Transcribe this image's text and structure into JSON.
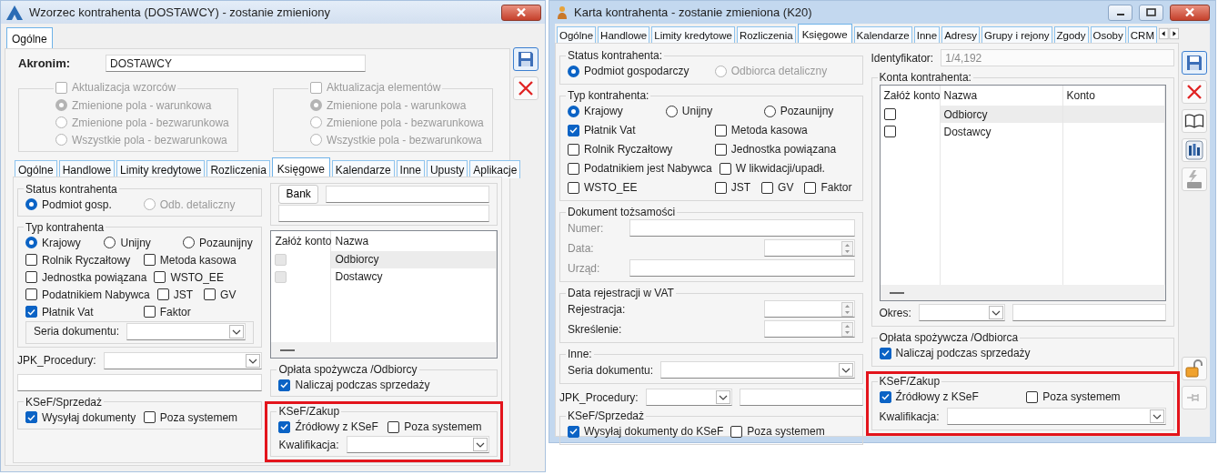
{
  "windows": [
    {
      "title": "Wzorzec kontrahenta (DOSTAWCY) - zostanie zmieniony",
      "title_buttons": [
        {
          "kind": "close"
        }
      ],
      "outer_tabs": [
        {
          "label": "Ogólne",
          "selected": true
        }
      ],
      "header": [
        [
          [
            {
              "kind": "strong",
              "text": "Akronim:"
            }
          ],
          [
            {
              "kind": "field",
              "value": "DOSTAWCY"
            }
          ]
        ],
        {
          "kind": "pair",
          "groups": [
            {
              "kind": "group",
              "title_check": {
                "kind": "check",
                "label": "Aktualizacja wzorców",
                "checked": false
              },
              "disabled": true,
              "highlighted": false,
              "items": [
                [
                  [
                    {
                      "kind": "radio",
                      "label": "Zmienione pola - warunkowa",
                      "selected": true
                    }
                  ]
                ],
                [
                  [
                    {
                      "kind": "radio",
                      "label": "Zmienione pola - bezwarunkowa",
                      "selected": false
                    }
                  ]
                ],
                [
                  [
                    {
                      "kind": "radio",
                      "label": "Wszystkie pola - bezwarunkowa",
                      "selected": false
                    }
                  ]
                ]
              ]
            },
            {
              "kind": "group",
              "title_check": {
                "kind": "check",
                "label": "Aktualizacja elementów",
                "checked": false
              },
              "disabled": true,
              "highlighted": false,
              "items": [
                [
                  [
                    {
                      "kind": "radio",
                      "label": "Zmienione pola - warunkowa",
                      "selected": true
                    }
                  ]
                ],
                [
                  [
                    {
                      "kind": "radio",
                      "label": "Zmienione pola - bezwarunkowa",
                      "selected": false
                    }
                  ]
                ],
                [
                  [
                    {
                      "kind": "radio",
                      "label": "Wszystkie pola - bezwarunkowa",
                      "selected": false
                    }
                  ]
                ]
              ]
            }
          ]
        }
      ],
      "tabs": [
        {
          "label": "Ogólne",
          "selected": false
        },
        {
          "label": "Handlowe",
          "selected": false
        },
        {
          "label": "Limity kredytowe",
          "selected": false
        },
        {
          "label": "Rozliczenia",
          "selected": false
        },
        {
          "label": "Księgowe",
          "selected": true
        },
        {
          "label": "Kalendarze",
          "selected": false
        },
        {
          "label": "Inne",
          "selected": false
        },
        {
          "label": "Upusty",
          "selected": false
        },
        {
          "label": "Aplikacje",
          "selected": false
        }
      ],
      "columns": [
        [
          {
            "kind": "group",
            "title": "Status kontrahenta",
            "highlighted": false,
            "items": [
              [
                [
                  {
                    "kind": "radio",
                    "label": "Podmiot gosp.",
                    "selected": true,
                    "disabled": false
                  }
                ],
                [
                  {
                    "kind": "radio",
                    "label": "Odb. detaliczny",
                    "selected": false,
                    "disabled": true
                  }
                ]
              ]
            ]
          },
          {
            "kind": "group",
            "title": "Typ kontrahenta",
            "highlighted": false,
            "items": [
              [
                [
                  {
                    "kind": "radio",
                    "label": "Krajowy",
                    "selected": true
                  }
                ],
                [
                  {
                    "kind": "radio",
                    "label": "Unijny",
                    "selected": false
                  }
                ],
                [
                  {
                    "kind": "radio",
                    "label": "Pozaunijny",
                    "selected": false
                  }
                ]
              ],
              [
                [
                  {
                    "kind": "check",
                    "label": "Rolnik Ryczałtowy",
                    "checked": false
                  }
                ],
                [
                  {
                    "kind": "check",
                    "label": "Metoda kasowa",
                    "checked": false
                  }
                ]
              ],
              [
                [
                  {
                    "kind": "check",
                    "label": "Jednostka powiązana",
                    "checked": false
                  }
                ],
                [
                  {
                    "kind": "check",
                    "label": "WSTO_EE",
                    "checked": false
                  }
                ]
              ],
              [
                [
                  {
                    "kind": "check",
                    "label": "Podatnikiem Nabywca",
                    "checked": false
                  }
                ],
                [
                  {
                    "kind": "check",
                    "label": "JST",
                    "checked": false
                  },
                  {
                    "kind": "check",
                    "label": "GV",
                    "checked": false
                  }
                ]
              ],
              [
                [
                  {
                    "kind": "check",
                    "label": "Płatnik Vat",
                    "checked": true
                  }
                ],
                [
                  {
                    "kind": "check",
                    "label": "Faktor",
                    "checked": false
                  }
                ]
              ],
              {
                "kind": "group",
                "highlighted": false,
                "items": [
                  [
                    [
                      {
                        "kind": "label",
                        "text": "Seria dokumentu:"
                      }
                    ],
                    [
                      {
                        "kind": "combo"
                      }
                    ]
                  ]
                ]
              }
            ]
          },
          [
            [
              {
                "kind": "label",
                "text": "JPK_Procedury:"
              }
            ],
            [
              {
                "kind": "combo"
              }
            ]
          ],
          [
            [
              {
                "kind": "field"
              }
            ]
          ],
          {
            "kind": "group",
            "title": "KSeF/Sprzedaż",
            "highlighted": false,
            "items": [
              [
                [
                  {
                    "kind": "check",
                    "label": "Wysyłaj dokumenty",
                    "checked": true
                  }
                ],
                [
                  {
                    "kind": "check",
                    "label": "Poza systemem",
                    "checked": false
                  }
                ]
              ]
            ]
          }
        ],
        [
          {
            "kind": "group",
            "highlighted": false,
            "items": [
              [
                [
                  {
                    "kind": "button",
                    "label": "Bank"
                  }
                ],
                [
                  {
                    "kind": "field"
                  }
                ]
              ],
              [
                [
                  {
                    "kind": "field"
                  }
                ]
              ]
            ]
          },
          {
            "kind": "grid",
            "columns": [
              "Załóż konto",
              "Nazwa"
            ],
            "rows": [
              {
                "checked": false,
                "disabled": true,
                "name": "Odbiorcy"
              },
              {
                "checked": false,
                "disabled": true,
                "name": "Dostawcy"
              }
            ]
          },
          {
            "kind": "group",
            "title": "Opłata spożywcza /Odbiorcy",
            "highlighted": false,
            "items": [
              [
                [
                  {
                    "kind": "check",
                    "label": "Naliczaj podczas sprzedaży",
                    "checked": true
                  }
                ]
              ]
            ]
          },
          {
            "kind": "group",
            "title": "KSeF/Zakup",
            "highlighted": true,
            "items": [
              [
                [
                  {
                    "kind": "check",
                    "label": "Źródłowy z KSeF",
                    "checked": true
                  }
                ],
                [
                  {
                    "kind": "check",
                    "label": "Poza systemem",
                    "checked": false
                  }
                ]
              ],
              [
                [
                  {
                    "kind": "label",
                    "text": "Kwalifikacja:"
                  }
                ],
                [
                  {
                    "kind": "combo"
                  }
                ]
              ]
            ]
          }
        ]
      ],
      "toolbar": [
        {
          "kind": "save",
          "disabled": false
        },
        {
          "kind": "cancel",
          "disabled": false
        }
      ]
    },
    {
      "title": "Karta kontrahenta - zostanie zmieniona (K20)",
      "title_buttons": [
        {
          "kind": "min"
        },
        {
          "kind": "max"
        },
        {
          "kind": "close"
        }
      ],
      "tabs": [
        {
          "label": "Ogólne",
          "selected": false
        },
        {
          "label": "Handlowe",
          "selected": false
        },
        {
          "label": "Limity kredytowe",
          "selected": false
        },
        {
          "label": "Rozliczenia",
          "selected": false
        },
        {
          "label": "Księgowe",
          "selected": true
        },
        {
          "label": "Kalendarze",
          "selected": false
        },
        {
          "label": "Inne",
          "selected": false
        },
        {
          "label": "Adresy",
          "selected": false
        },
        {
          "label": "Grupy i rejony",
          "selected": false
        },
        {
          "label": "Zgody",
          "selected": false
        },
        {
          "label": "Osoby",
          "selected": false
        },
        {
          "label": "CRM",
          "selected": false
        }
      ],
      "columns": [
        [
          {
            "kind": "group",
            "title": "Status kontrahenta:",
            "highlighted": false,
            "items": [
              [
                [
                  {
                    "kind": "radio",
                    "label": "Podmiot gospodarczy",
                    "selected": true,
                    "disabled": false
                  }
                ],
                [
                  {
                    "kind": "radio",
                    "label": "Odbiorca detaliczny",
                    "selected": false,
                    "disabled": true
                  }
                ]
              ]
            ]
          },
          {
            "kind": "group",
            "title": "Typ kontrahenta:",
            "highlighted": false,
            "items": [
              [
                [
                  {
                    "kind": "radio",
                    "label": "Krajowy",
                    "selected": true
                  }
                ],
                [
                  {
                    "kind": "radio",
                    "label": "Unijny",
                    "selected": false
                  }
                ],
                [
                  {
                    "kind": "radio",
                    "label": "Pozaunijny",
                    "selected": false
                  }
                ]
              ],
              [
                [
                  {
                    "kind": "check",
                    "label": "Płatnik Vat",
                    "checked": true
                  }
                ],
                [
                  {
                    "kind": "check",
                    "label": "Metoda kasowa",
                    "checked": false
                  }
                ]
              ],
              [
                [
                  {
                    "kind": "check",
                    "label": "Rolnik Ryczałtowy",
                    "checked": false
                  }
                ],
                [
                  {
                    "kind": "check",
                    "label": "Jednostka powiązana",
                    "checked": false
                  }
                ]
              ],
              [
                [
                  {
                    "kind": "check",
                    "label": "Podatnikiem jest Nabywca",
                    "checked": false
                  }
                ],
                [
                  {
                    "kind": "check",
                    "label": "W likwidacji/upadł.",
                    "checked": false
                  }
                ]
              ],
              [
                [
                  {
                    "kind": "check",
                    "label": "WSTO_EE",
                    "checked": false
                  }
                ],
                [
                  {
                    "kind": "check",
                    "label": "JST",
                    "checked": false
                  },
                  {
                    "kind": "check",
                    "label": "GV",
                    "checked": false
                  },
                  {
                    "kind": "check",
                    "label": "Faktor",
                    "checked": false
                  }
                ]
              ]
            ]
          },
          {
            "kind": "group",
            "title": "Dokument tożsamości",
            "highlighted": false,
            "items": [
              [
                [
                  {
                    "kind": "dim-label",
                    "text": "Numer:"
                  }
                ],
                [
                  {
                    "kind": "field"
                  }
                ]
              ],
              [
                [
                  {
                    "kind": "dim-label",
                    "text": "Data:"
                  }
                ],
                [
                  {
                    "kind": "spin"
                  }
                ]
              ],
              [
                [
                  {
                    "kind": "dim-label",
                    "text": "Urząd:"
                  }
                ],
                [
                  {
                    "kind": "field"
                  }
                ]
              ]
            ]
          },
          {
            "kind": "group",
            "title": "Data rejestracji w VAT",
            "highlighted": false,
            "items": [
              [
                [
                  {
                    "kind": "label",
                    "text": "Rejestracja:"
                  }
                ],
                [
                  {
                    "kind": "spin"
                  }
                ]
              ],
              [
                [
                  {
                    "kind": "label",
                    "text": "Skreślenie:"
                  }
                ],
                [
                  {
                    "kind": "spin"
                  }
                ]
              ]
            ]
          },
          {
            "kind": "group",
            "title": "Inne:",
            "highlighted": false,
            "items": [
              [
                [
                  {
                    "kind": "label",
                    "text": "Seria dokumentu:"
                  }
                ],
                [
                  {
                    "kind": "combo"
                  }
                ]
              ]
            ]
          },
          [
            [
              {
                "kind": "label",
                "text": "JPK_Procedury:"
              }
            ],
            [
              {
                "kind": "combo"
              }
            ],
            [
              {
                "kind": "field"
              }
            ]
          ],
          {
            "kind": "group",
            "title": "KSeF/Sprzedaż",
            "highlighted": false,
            "items": [
              [
                [
                  {
                    "kind": "check",
                    "label": "Wysyłaj dokumenty do KSeF",
                    "checked": true
                  }
                ],
                [
                  {
                    "kind": "check",
                    "label": "Poza systemem",
                    "checked": false
                  }
                ]
              ]
            ]
          }
        ],
        [
          [
            [
              {
                "kind": "label",
                "text": "Identyfikator:"
              }
            ],
            [
              {
                "kind": "readonly-field",
                "value": "1/4,192"
              }
            ]
          ],
          {
            "kind": "group",
            "title": "Konta kontrahenta:",
            "highlighted": false,
            "items": [
              {
                "kind": "grid",
                "columns": [
                  "Załóż konto",
                  "Nazwa",
                  "Konto"
                ],
                "rows": [
                  {
                    "checked": false,
                    "disabled": false,
                    "name": "Odbiorcy"
                  },
                  {
                    "checked": false,
                    "disabled": false,
                    "name": "Dostawcy"
                  }
                ]
              },
              [
                [
                  {
                    "kind": "label",
                    "text": "Okres:"
                  }
                ],
                [
                  {
                    "kind": "combo"
                  }
                ],
                [
                  {
                    "kind": "field"
                  }
                ]
              ]
            ]
          },
          {
            "kind": "group",
            "title": "Opłata spożywcza /Odbiorca",
            "highlighted": false,
            "items": [
              [
                [
                  {
                    "kind": "check",
                    "label": "Naliczaj podczas sprzedaży",
                    "checked": true
                  }
                ]
              ]
            ]
          },
          {
            "kind": "group",
            "title": "KSeF/Zakup",
            "highlighted": true,
            "items": [
              [
                [
                  {
                    "kind": "check",
                    "label": "Źródłowy z KSeF",
                    "checked": true
                  }
                ],
                [
                  {
                    "kind": "check",
                    "label": "Poza systemem",
                    "checked": false
                  }
                ]
              ],
              [
                [
                  {
                    "kind": "label",
                    "text": "Kwalifikacja:"
                  }
                ],
                [
                  {
                    "kind": "combo"
                  }
                ]
              ]
            ]
          }
        ]
      ],
      "toolbar": [
        {
          "kind": "save",
          "disabled": false
        },
        {
          "kind": "cancel",
          "disabled": false
        },
        {
          "kind": "book",
          "disabled": false
        },
        {
          "kind": "badge",
          "disabled": false
        },
        {
          "kind": "lightning",
          "disabled": true
        }
      ],
      "toolbar_bottom": [
        {
          "kind": "lock",
          "disabled": false
        },
        {
          "kind": "pin",
          "disabled": true
        }
      ]
    }
  ]
}
